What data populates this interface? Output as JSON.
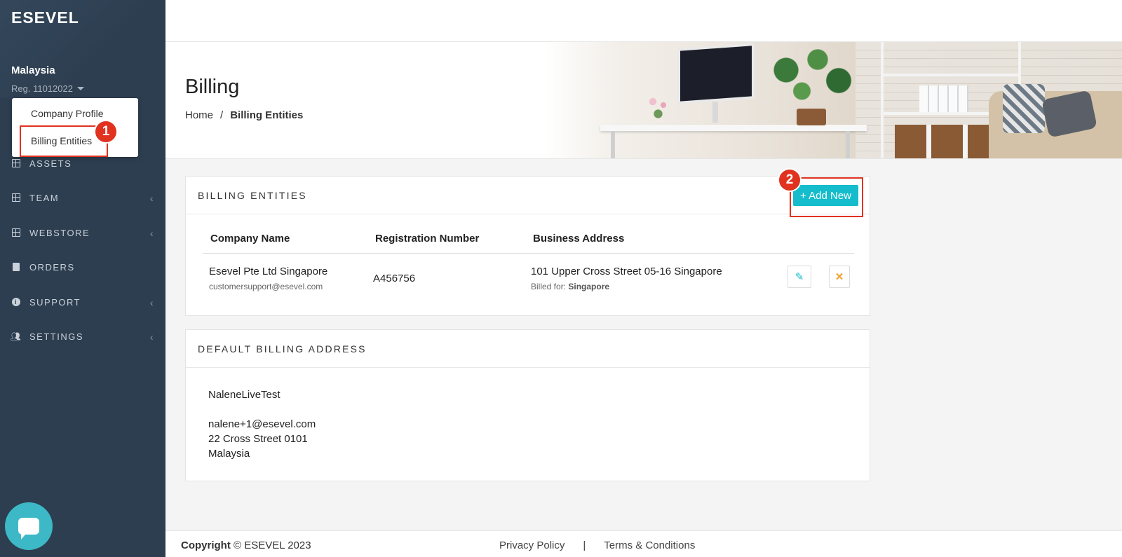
{
  "app": {
    "logo": "ESEVEL"
  },
  "company": {
    "name": "Malaysia",
    "reg": "Reg. 11012022"
  },
  "dropdown": {
    "items": [
      "Company Profile",
      "Billing Entities"
    ]
  },
  "sidebar": {
    "items": [
      {
        "label": "ASSETS",
        "icon": "grid-icon"
      },
      {
        "label": "TEAM",
        "icon": "grid-icon",
        "chevron": "‹"
      },
      {
        "label": "WEBSTORE",
        "icon": "grid-icon",
        "chevron": "‹"
      },
      {
        "label": "ORDERS",
        "icon": "document-icon"
      },
      {
        "label": "SUPPORT",
        "icon": "info-icon",
        "chevron": "‹"
      },
      {
        "label": "SETTINGS",
        "icon": "users-icon",
        "chevron": "‹"
      }
    ]
  },
  "annotations": {
    "step1": "1",
    "step2": "2"
  },
  "header": {
    "title": "Billing",
    "breadcrumb": {
      "home": "Home",
      "separator": "/",
      "current": "Billing Entities"
    }
  },
  "billing_entities": {
    "title": "BILLING ENTITIES",
    "add_label": "+ Add New",
    "columns": [
      "Company Name",
      "Registration Number",
      "Business Address"
    ],
    "rows": [
      {
        "company": "Esevel Pte Ltd Singapore",
        "email": "customersupport@esevel.com",
        "reg": "A456756",
        "address": "101 Upper Cross Street 05-16 Singapore",
        "billed_label": "Billed for:",
        "billed_value": "Singapore"
      }
    ]
  },
  "default_billing": {
    "title": "DEFAULT BILLING ADDRESS",
    "name": "NaleneLiveTest",
    "email": "nalene+1@esevel.com",
    "street": "22 Cross Street 0101",
    "country": "Malaysia"
  },
  "footer": {
    "copyright_label": "Copyright",
    "copyright_text": "© ESEVEL 2023",
    "privacy": "Privacy Policy",
    "separator": "|",
    "terms": "Terms & Conditions"
  },
  "colors": {
    "sidebar": "#2d3e50",
    "accent": "#15bccb",
    "highlight": "#e0321f",
    "warn": "#f0a22e"
  }
}
